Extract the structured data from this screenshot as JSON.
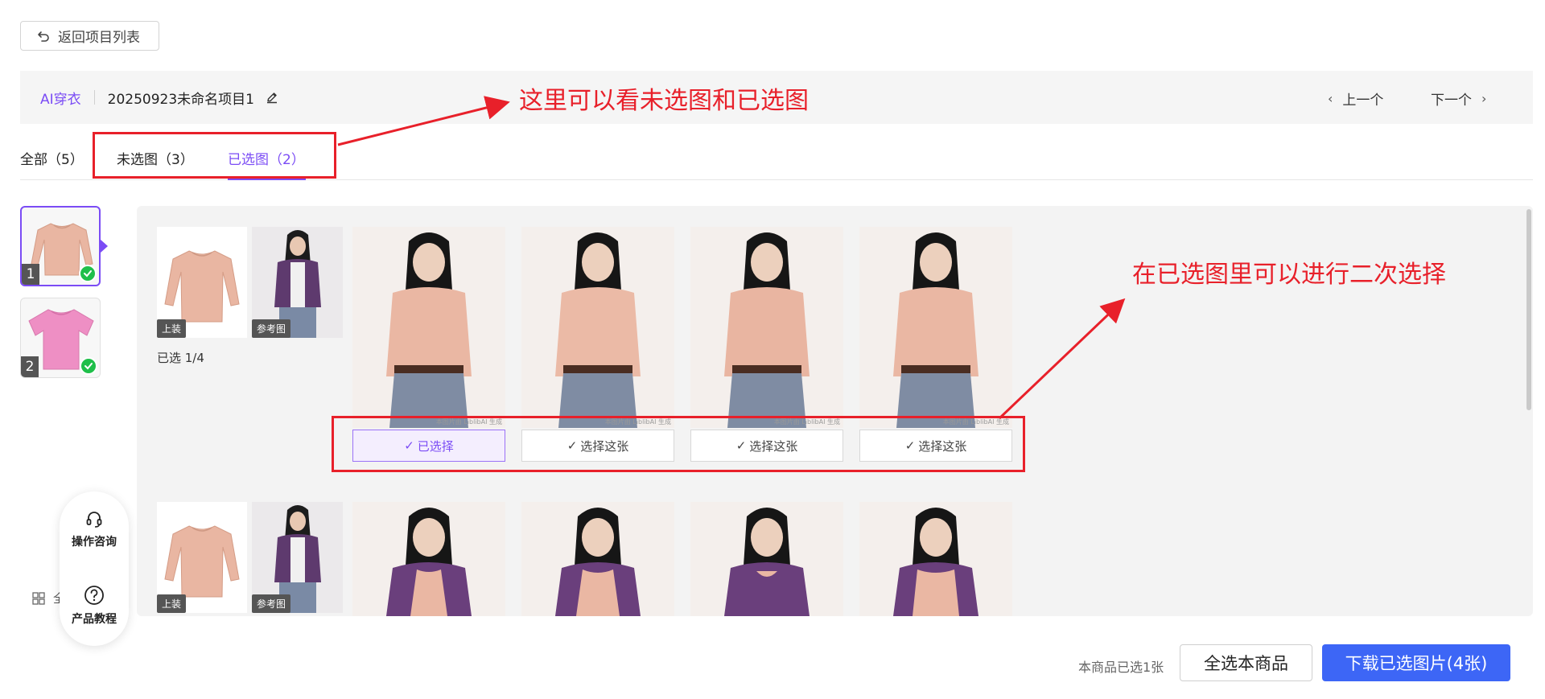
{
  "back_button": {
    "label": "返回项目列表"
  },
  "header": {
    "app_name": "AI穿衣",
    "project_name": "20250923未命名项目1",
    "prev_label": "上一个",
    "next_label": "下一个"
  },
  "tabs": [
    {
      "label": "全部（5）",
      "active": false
    },
    {
      "label": "未选图（3）",
      "active": false
    },
    {
      "label": "已选图（2）",
      "active": true
    }
  ],
  "annotations": {
    "top_note": "这里可以看未选图和已选图",
    "right_note": "在已选图里可以进行二次选择"
  },
  "products": [
    {
      "number": "1",
      "selected": true,
      "color": "#e9b6a2"
    },
    {
      "number": "2",
      "selected": true,
      "color": "#ee8fc4"
    }
  ],
  "groups": [
    {
      "garment_tag": "上装",
      "reference_tag": "参考图",
      "selected_count": "已选 1/4",
      "watermark": "本图片由 LiblibAI 生成",
      "buttons": [
        {
          "label": "已选择",
          "chosen": true
        },
        {
          "label": "选择这张",
          "chosen": false
        },
        {
          "label": "选择这张",
          "chosen": false
        },
        {
          "label": "选择这张",
          "chosen": false
        }
      ]
    },
    {
      "garment_tag": "上装",
      "reference_tag": "参考图"
    }
  ],
  "float_help": {
    "consult_label": "操作咨询",
    "tutorial_label": "产品教程"
  },
  "partial_footer_text": "全",
  "bottom_bar": {
    "selected_info": "本商品已选1张",
    "select_all_label": "全选本商品",
    "download_label": "下载已选图片(4张)"
  },
  "colors": {
    "accent": "#7b4cf5",
    "download_button": "#3d66f6",
    "annotation": "#e8202a",
    "check_green": "#1fbf4a"
  }
}
